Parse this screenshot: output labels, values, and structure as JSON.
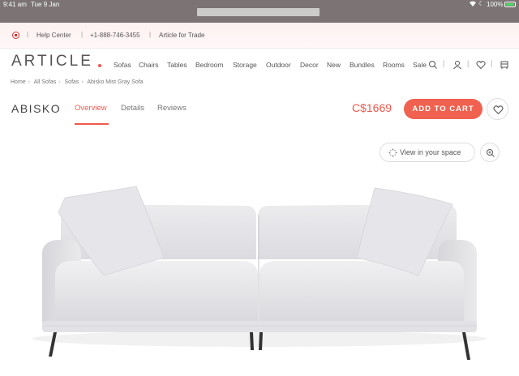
{
  "status_bar": {
    "time": "9:41 am",
    "date": "Tue 9 Jan",
    "battery": "100%"
  },
  "utility_bar": {
    "help": "Help Center",
    "phone": "+1-888-746-3455",
    "trade": "Article for Trade"
  },
  "nav": {
    "logo": "ARTICLE",
    "links": [
      "Sofas",
      "Chairs",
      "Tables",
      "Bedroom",
      "Storage",
      "Outdoor",
      "Decor",
      "New",
      "Bundles",
      "Rooms",
      "Sale"
    ]
  },
  "breadcrumb": [
    "Home",
    "All Sofas",
    "Sofas",
    "Abisko Mist Gray Sofa"
  ],
  "product": {
    "name": "ABISKO",
    "tabs": [
      "Overview",
      "Details",
      "Reviews"
    ],
    "active_tab": "Overview",
    "price": "C$1669",
    "cart_label": "ADD TO CART",
    "view_space_label": "View in your space"
  },
  "colors": {
    "accent": "#ef5a4c",
    "sofa": "#e4e4e7"
  },
  "icons": [
    "search-icon",
    "user-icon",
    "heart-icon",
    "cart-icon",
    "ar-icon",
    "zoom-icon",
    "canada-flag-icon"
  ]
}
